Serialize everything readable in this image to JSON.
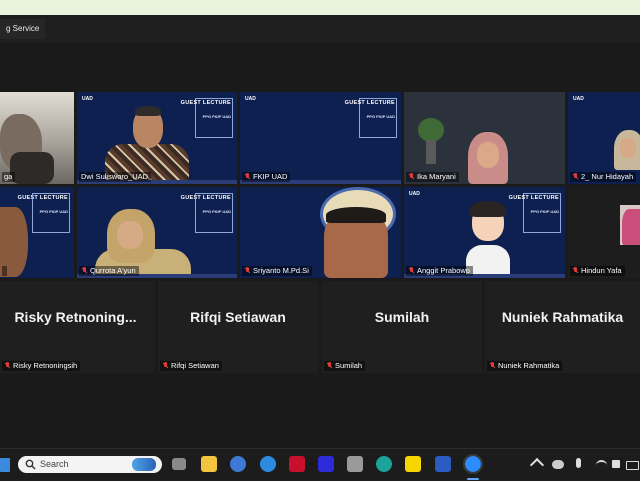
{
  "window": {
    "title": "g Service"
  },
  "tiles_row1": [
    {
      "name": "ga"
    },
    {
      "name": "Dwi Sulisworo_UAD"
    },
    {
      "name": "FKIP UAD"
    },
    {
      "name": "Ika Maryani"
    },
    {
      "name": "2_ Nur Hidayah"
    }
  ],
  "tiles_row2": [
    {
      "name": ""
    },
    {
      "name": "Qurrota A'yun"
    },
    {
      "name": "Sriyanto M.Pd.Si"
    },
    {
      "name": "Anggit Prabowo"
    },
    {
      "name": "Hindun Yafa"
    }
  ],
  "tiles_row3": [
    {
      "big": "Risky  Retnoning...",
      "name": "Risky Retnoningsih"
    },
    {
      "big": "Rifqi Setiawan",
      "name": "Rifqi Setiawan"
    },
    {
      "big": "Sumilah",
      "name": "Sumilah"
    },
    {
      "big": "Nuniek Rahmatika",
      "name": "Nuniek Rahmatika"
    }
  ],
  "slide": {
    "logo": "UAD",
    "heading": "GUEST LECTURE",
    "sub": "PPG FKIP UAD"
  },
  "taskbar": {
    "search_placeholder": "Search"
  },
  "colors": {
    "slide_bg": "#0e2050",
    "speaker_border": "#c7e34a",
    "muted_mic": "#e23b3b"
  }
}
